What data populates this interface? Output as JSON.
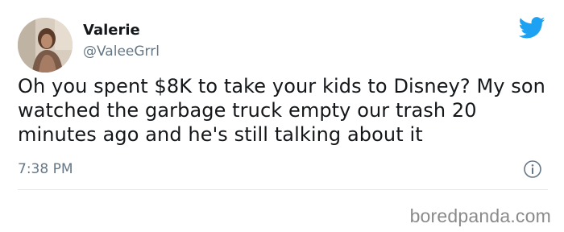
{
  "tweet": {
    "author_name": "Valerie",
    "author_handle": "@ValeeGrrl",
    "text": "Oh you spent $8K to take your kids to Disney? My son watched the garbage truck empty our trash 20 minutes ago and he's still talking about it",
    "timestamp": "7:38 PM"
  },
  "icons": {
    "brand": "twitter-bird-icon",
    "info": "info-icon"
  },
  "colors": {
    "twitter_blue": "#1da1f2",
    "secondary_text": "#657786",
    "divider": "#e1e8ed"
  },
  "watermark": "boredpanda.com"
}
